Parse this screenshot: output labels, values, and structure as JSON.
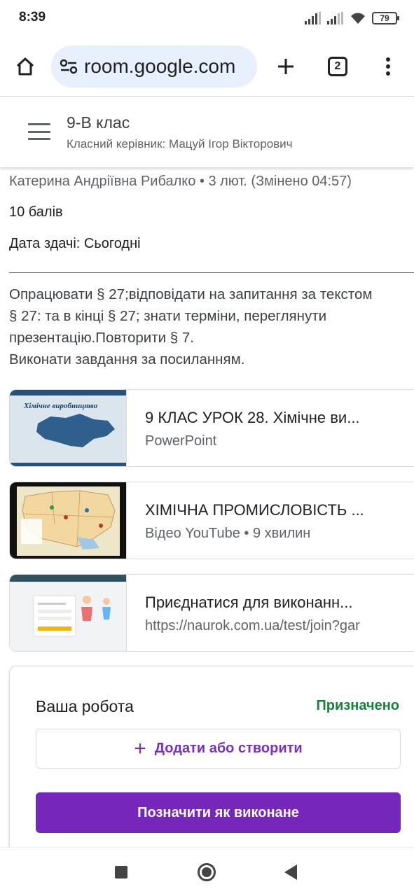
{
  "status_bar": {
    "time": "8:39",
    "battery": "79"
  },
  "browser": {
    "url": "room.google.com",
    "tab_count": "2"
  },
  "class_header": {
    "title": "9-В клас",
    "subtitle": "Класний керівник: Мацуй Ігор Вікторович"
  },
  "assignment": {
    "meta": "Катерина Андріївна Рибалко • 3 лют. (Змінено 04:57)",
    "points": "10 балів",
    "due": "Дата здачі: Сьогодні",
    "instructions": [
      "Опрацювати § 27;відповідати на запитання за текстом",
      "§ 27: та в кінці § 27; знати терміни, переглянути",
      "презентацію.Повторити § 7.",
      "Виконати завдання за посиланням."
    ]
  },
  "attachments": [
    {
      "title": "9 КЛАС УРОК 28. Хімічне ви...",
      "subtitle": "PowerPoint",
      "thumb_caption": "Хімічне виробництво"
    },
    {
      "title": "ХІМІЧНА ПРОМИСЛОВІСТЬ ...",
      "subtitle": "Відео YouTube • 9 хвилин"
    },
    {
      "title": "Приєднатися для виконанн...",
      "subtitle": "https://naurok.com.ua/test/join?gar"
    }
  ],
  "your_work": {
    "title": "Ваша робота",
    "status": "Призначено",
    "add_label": "Додати або створити",
    "done_label": "Позначити як виконане"
  },
  "colors": {
    "accent": "#7627bb",
    "status_green": "#188038",
    "url_bg": "#e8f0fe"
  }
}
